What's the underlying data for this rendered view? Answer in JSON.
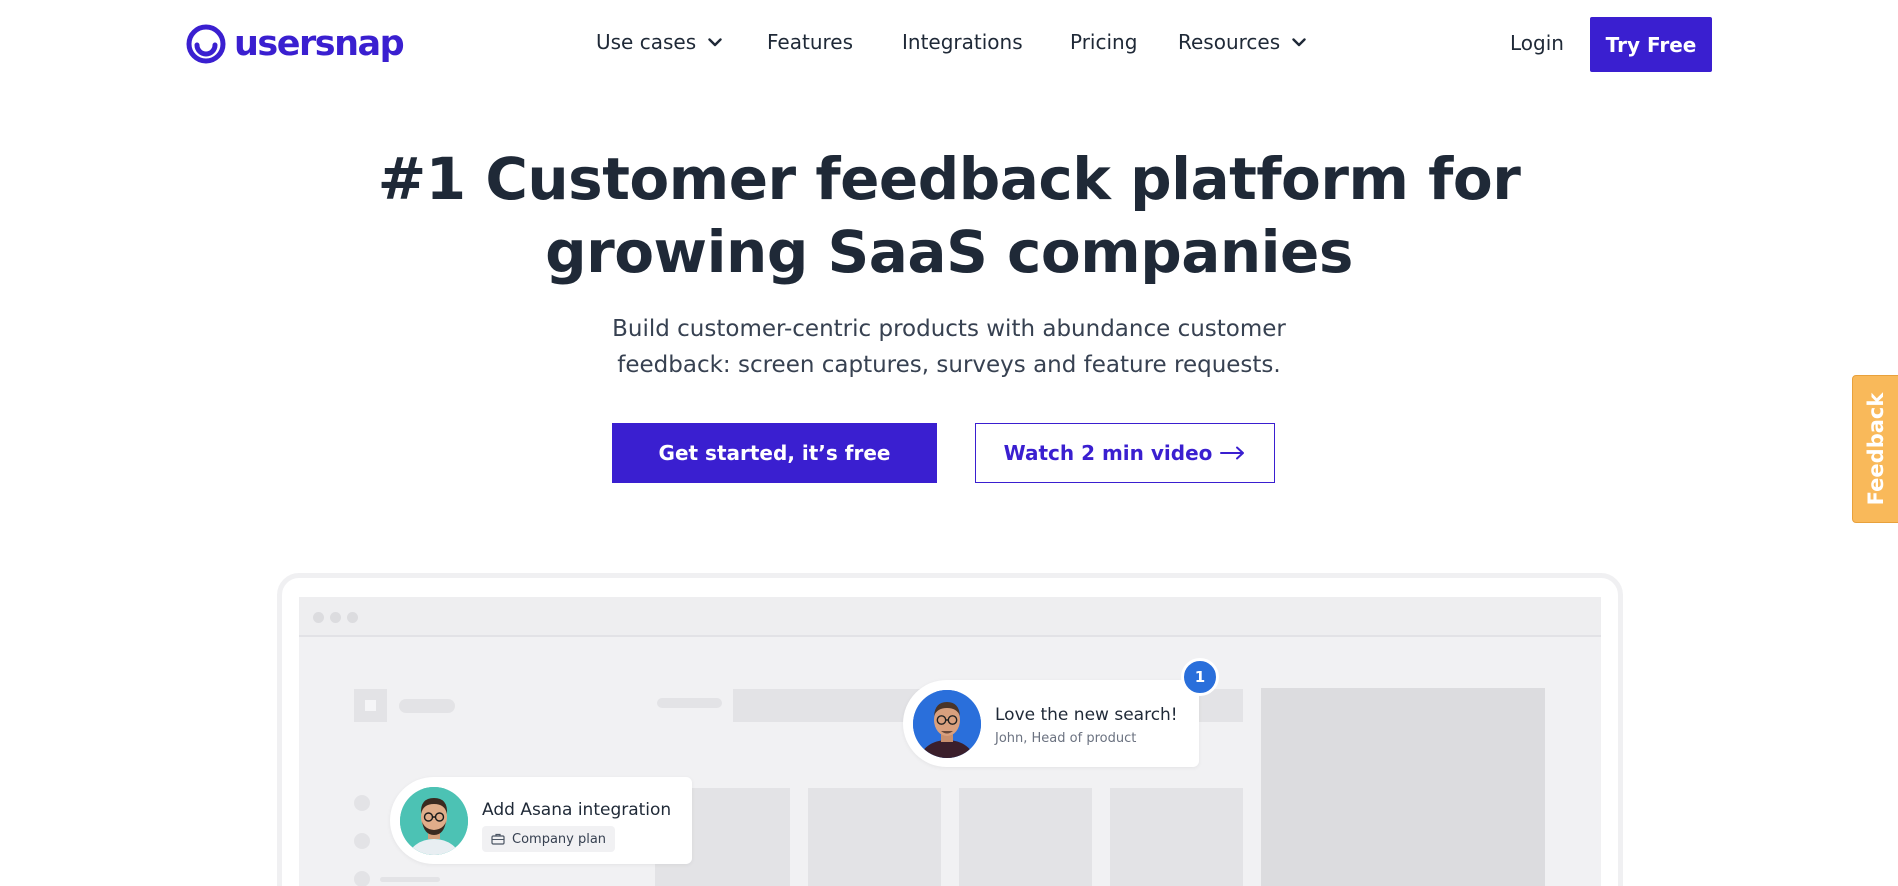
{
  "brand": {
    "name": "usersnap",
    "color": "#3a1fd0"
  },
  "nav": {
    "links": [
      {
        "label": "Use cases",
        "dropdown": true
      },
      {
        "label": "Features",
        "dropdown": false
      },
      {
        "label": "Integrations",
        "dropdown": false
      },
      {
        "label": "Pricing",
        "dropdown": false
      },
      {
        "label": "Resources",
        "dropdown": true
      }
    ],
    "login_label": "Login",
    "try_free_label": "Try Free"
  },
  "hero": {
    "title_line1": "#1 Customer feedback platform for",
    "title_line2": "growing SaaS companies",
    "subtitle_line1": "Build customer-centric products with abundance customer",
    "subtitle_line2": "feedback: screen captures, surveys and feature requests.",
    "primary_cta": "Get started, it’s free",
    "secondary_cta": "Watch 2 min video"
  },
  "feedback_tab": {
    "label": "Feedback",
    "color": "#f9b95a"
  },
  "mockup": {
    "comment_card": {
      "message": "Love the new search!",
      "author": "John, Head of product",
      "badge": "1",
      "badge_color": "#2a6fdb"
    },
    "request_card": {
      "message": "Add Asana integration",
      "tag": "Company plan"
    }
  }
}
